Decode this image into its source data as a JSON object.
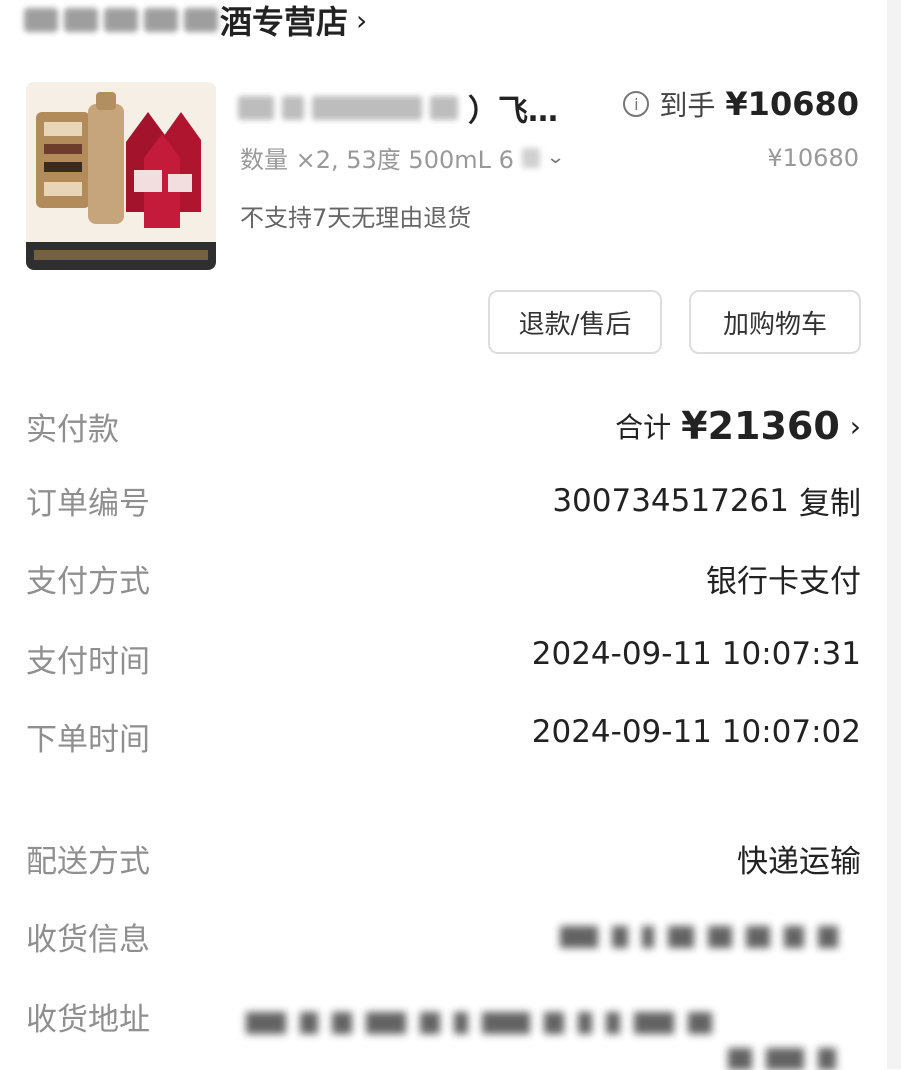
{
  "store": {
    "name": "酒专营店",
    "chevron": "›"
  },
  "product": {
    "image_alt": "product-image",
    "title_visible": "）飞…",
    "price_label": "到手",
    "price": "¥10680",
    "info_icon": "info-icon",
    "spec": "数量 ×2, 53度 500mL 6",
    "unit_price": "¥10680",
    "no_return": "不支持7天无理由退货"
  },
  "buttons": {
    "refund": "退款/售后",
    "add_cart": "加购物车"
  },
  "details": {
    "paid": {
      "label": "实付款",
      "value_prefix": "合计",
      "value": "¥21360"
    },
    "order_no": {
      "label": "订单编号",
      "value": "300734517261",
      "copy": "复制"
    },
    "pay_method": {
      "label": "支付方式",
      "value": "银行卡支付"
    },
    "pay_time": {
      "label": "支付时间",
      "value": "2024-09-11 10:07:31"
    },
    "order_time": {
      "label": "下单时间",
      "value": "2024-09-11 10:07:02"
    },
    "delivery": {
      "label": "配送方式",
      "value": "快递运输"
    },
    "receiver": {
      "label": "收货信息"
    },
    "address": {
      "label": "收货地址"
    }
  },
  "colors": {
    "primary_text": "#222222",
    "muted_text": "#8f8f8f",
    "border": "#dddddd"
  }
}
